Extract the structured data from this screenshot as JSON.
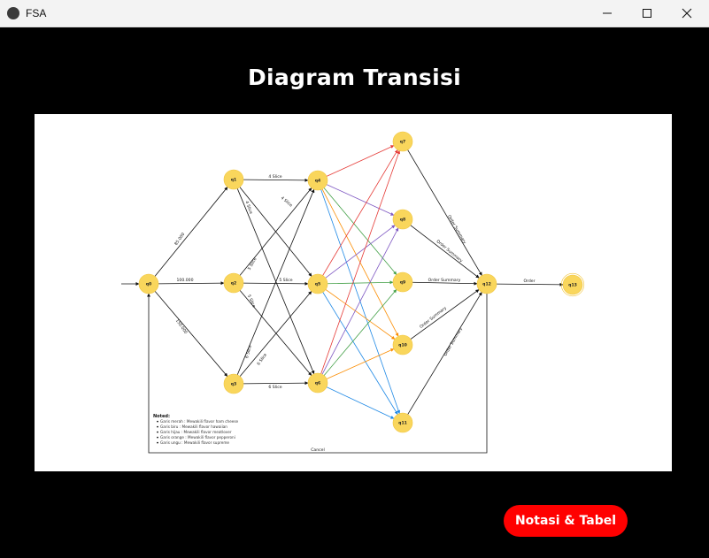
{
  "window": {
    "title": "FSA",
    "icon": "kivy-icon",
    "controls": [
      "minimize-icon",
      "maximize-icon",
      "close-icon"
    ]
  },
  "heading": "Diagram Transisi",
  "diagram": {
    "states": [
      "q0",
      "q1",
      "q2",
      "q3",
      "q4",
      "q5",
      "q6",
      "q7",
      "q8",
      "q9",
      "q10",
      "q11",
      "q12",
      "q13"
    ],
    "edge_labels": {
      "q0_q1": "85.000",
      "q0_q2": "100.000",
      "q0_q3": "150.000",
      "q1_q4": "4 Slice",
      "q1_q5": "4 Slice",
      "q1_q6": "4 Slice",
      "q2_q4": "5 Slice",
      "q2_q5": "5 Slice",
      "q2_q6": "5 Slice",
      "q3_q4": "6 Slice",
      "q3_q5": "6 Slice",
      "q3_q6": "6 Slice",
      "q7_q12": "Order Summary",
      "q8_q12": "Order Summary",
      "q9_q12": "Order Summary",
      "q10_q12": "Order Summary",
      "q11_q12": "Order Summary",
      "q12_q13": "Order",
      "cancel": "Cancel"
    },
    "edge_colors": [
      "#e53935",
      "#7e57c2",
      "#43a047",
      "#fb8c00",
      "#1e88e5"
    ],
    "state_fill": "#f9d65c",
    "notes": {
      "title": "Noted:",
      "items": [
        "Garis merah : Mewakili flavor ham cheese",
        "Garis biru : Mewakili flavor hawaiian",
        "Garis hijau : Mewakili flavor meatlover",
        "Garis orange : Mewakili flavor pepperoni",
        "Garis ungu : Mewakili flavor supreme"
      ]
    }
  },
  "action_button": {
    "label": "Notasi & Tabel",
    "color": "#ff0000"
  }
}
